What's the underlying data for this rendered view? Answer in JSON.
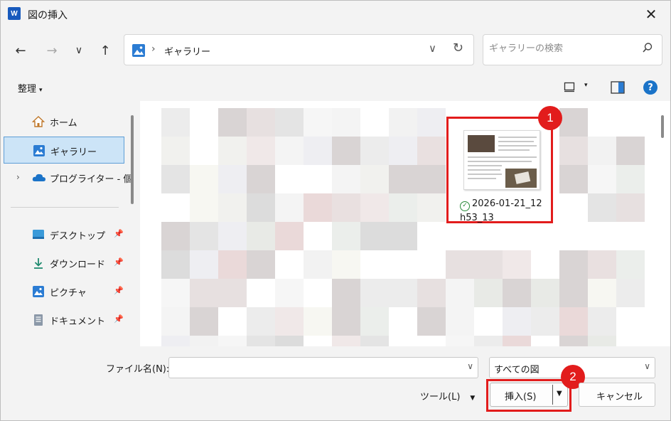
{
  "window": {
    "title": "図の挿入",
    "app_icon": "W"
  },
  "nav": {
    "back_icon": "←",
    "forward_icon": "→",
    "recent_icon": "∨",
    "up_icon": "↑",
    "address_sep": "›",
    "address_path": "ギャラリー",
    "address_dropdown": "∨",
    "refresh_icon": "↻",
    "search_placeholder": "ギャラリーの検索"
  },
  "toolbar": {
    "organize_label": "整理",
    "organize_caret": "▾",
    "view_caret": "▾",
    "help_label": "?"
  },
  "sidebar": {
    "items": [
      {
        "label": "ホーム"
      },
      {
        "label": "ギャラリー",
        "selected": true
      },
      {
        "label": "プログライター - 個",
        "chevron": "›"
      },
      {
        "label": "デスクトップ",
        "pin": "📌"
      },
      {
        "label": "ダウンロード",
        "pin": "📌"
      },
      {
        "label": "ピクチャ",
        "pin": "📌"
      },
      {
        "label": "ドキュメント",
        "pin": "📌"
      }
    ]
  },
  "content": {
    "selected_file": {
      "name_line1": "2026-01-21_12",
      "name_line2": "h53_13",
      "status_icon": "✓"
    }
  },
  "annotations": {
    "badge1": "1",
    "badge2": "2",
    "highlight_color": "#e21c1c"
  },
  "footer": {
    "filename_label": "ファイル名(N):",
    "filename_value": "",
    "filename_dropdown": "∨",
    "filter_value": "すべての図",
    "filter_dropdown": "∨",
    "tools_label": "ツール(L)",
    "tools_caret": "▼",
    "insert_label": "挿入(S)",
    "insert_arrow": "▼",
    "cancel_label": "キャンセル"
  }
}
